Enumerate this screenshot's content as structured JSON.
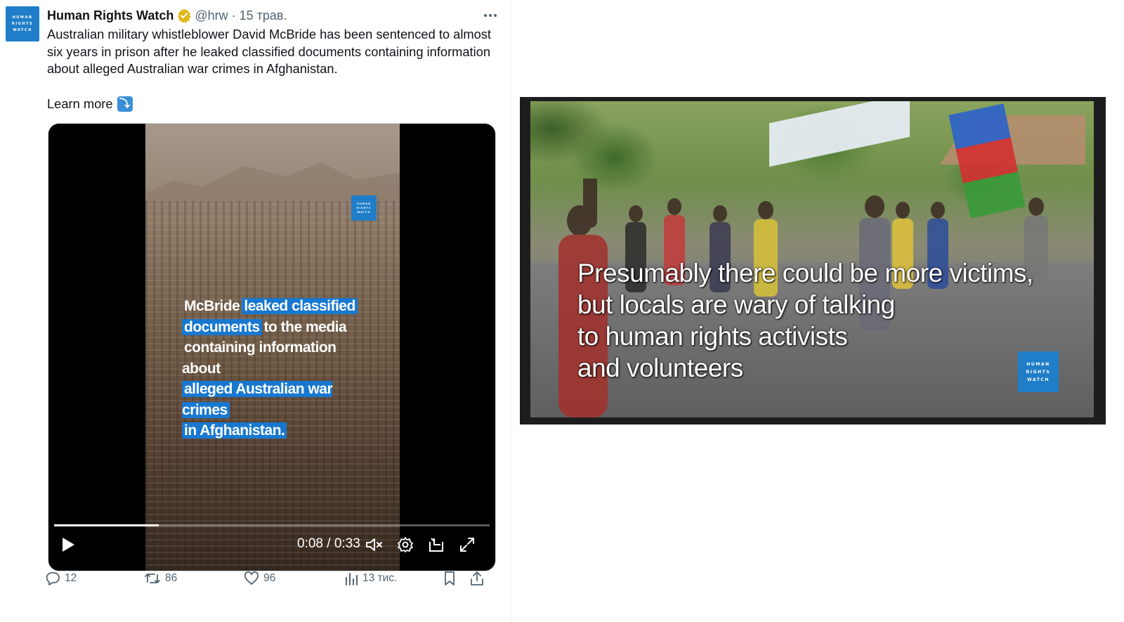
{
  "tweet": {
    "avatar_logo": [
      "HUMAN",
      "RIGHTS",
      "WATCH"
    ],
    "author_name": "Human Rights Watch",
    "handle": "@hrw",
    "separator": "·",
    "date": "15 трав.",
    "text": "Australian military whistleblower David McBride has been sentenced to almost six years in prison after he leaked classified documents containing information about alleged Australian war crimes in Afghanistan.",
    "learn_more": "Learn more",
    "learn_more_emoji": "⤵",
    "verified_color": "#e2b719",
    "brand_color": "#1f7ec7"
  },
  "video": {
    "logo": [
      "HUMAN",
      "RIGHTS",
      "WATCH"
    ],
    "caption_segments": [
      {
        "text": "McBride",
        "highlight": false
      },
      {
        "text": "leaked classified",
        "highlight": true
      },
      {
        "text": "documents",
        "highlight": true
      },
      {
        "text": "to the media",
        "highlight": false
      },
      {
        "text": "containing information about",
        "highlight": false
      },
      {
        "text": "alleged Australian war crimes",
        "highlight": true
      },
      {
        "text": "in Afghanistan.",
        "highlight": true
      }
    ],
    "time": "0:08 / 0:33",
    "progress": 0.24,
    "icons": [
      "play-icon",
      "mute-icon",
      "settings-icon",
      "minimize-icon",
      "fullscreen-icon"
    ]
  },
  "actions": {
    "replies": "12",
    "reposts": "86",
    "likes": "96",
    "views": "13 тис."
  },
  "second_video": {
    "caption_lines": [
      "Presumably there could be more victims,",
      "but locals are wary of talking",
      "to human rights activists",
      "and volunteers"
    ],
    "logo": [
      "HUMAN",
      "RIGHTS",
      "WATCH"
    ]
  }
}
